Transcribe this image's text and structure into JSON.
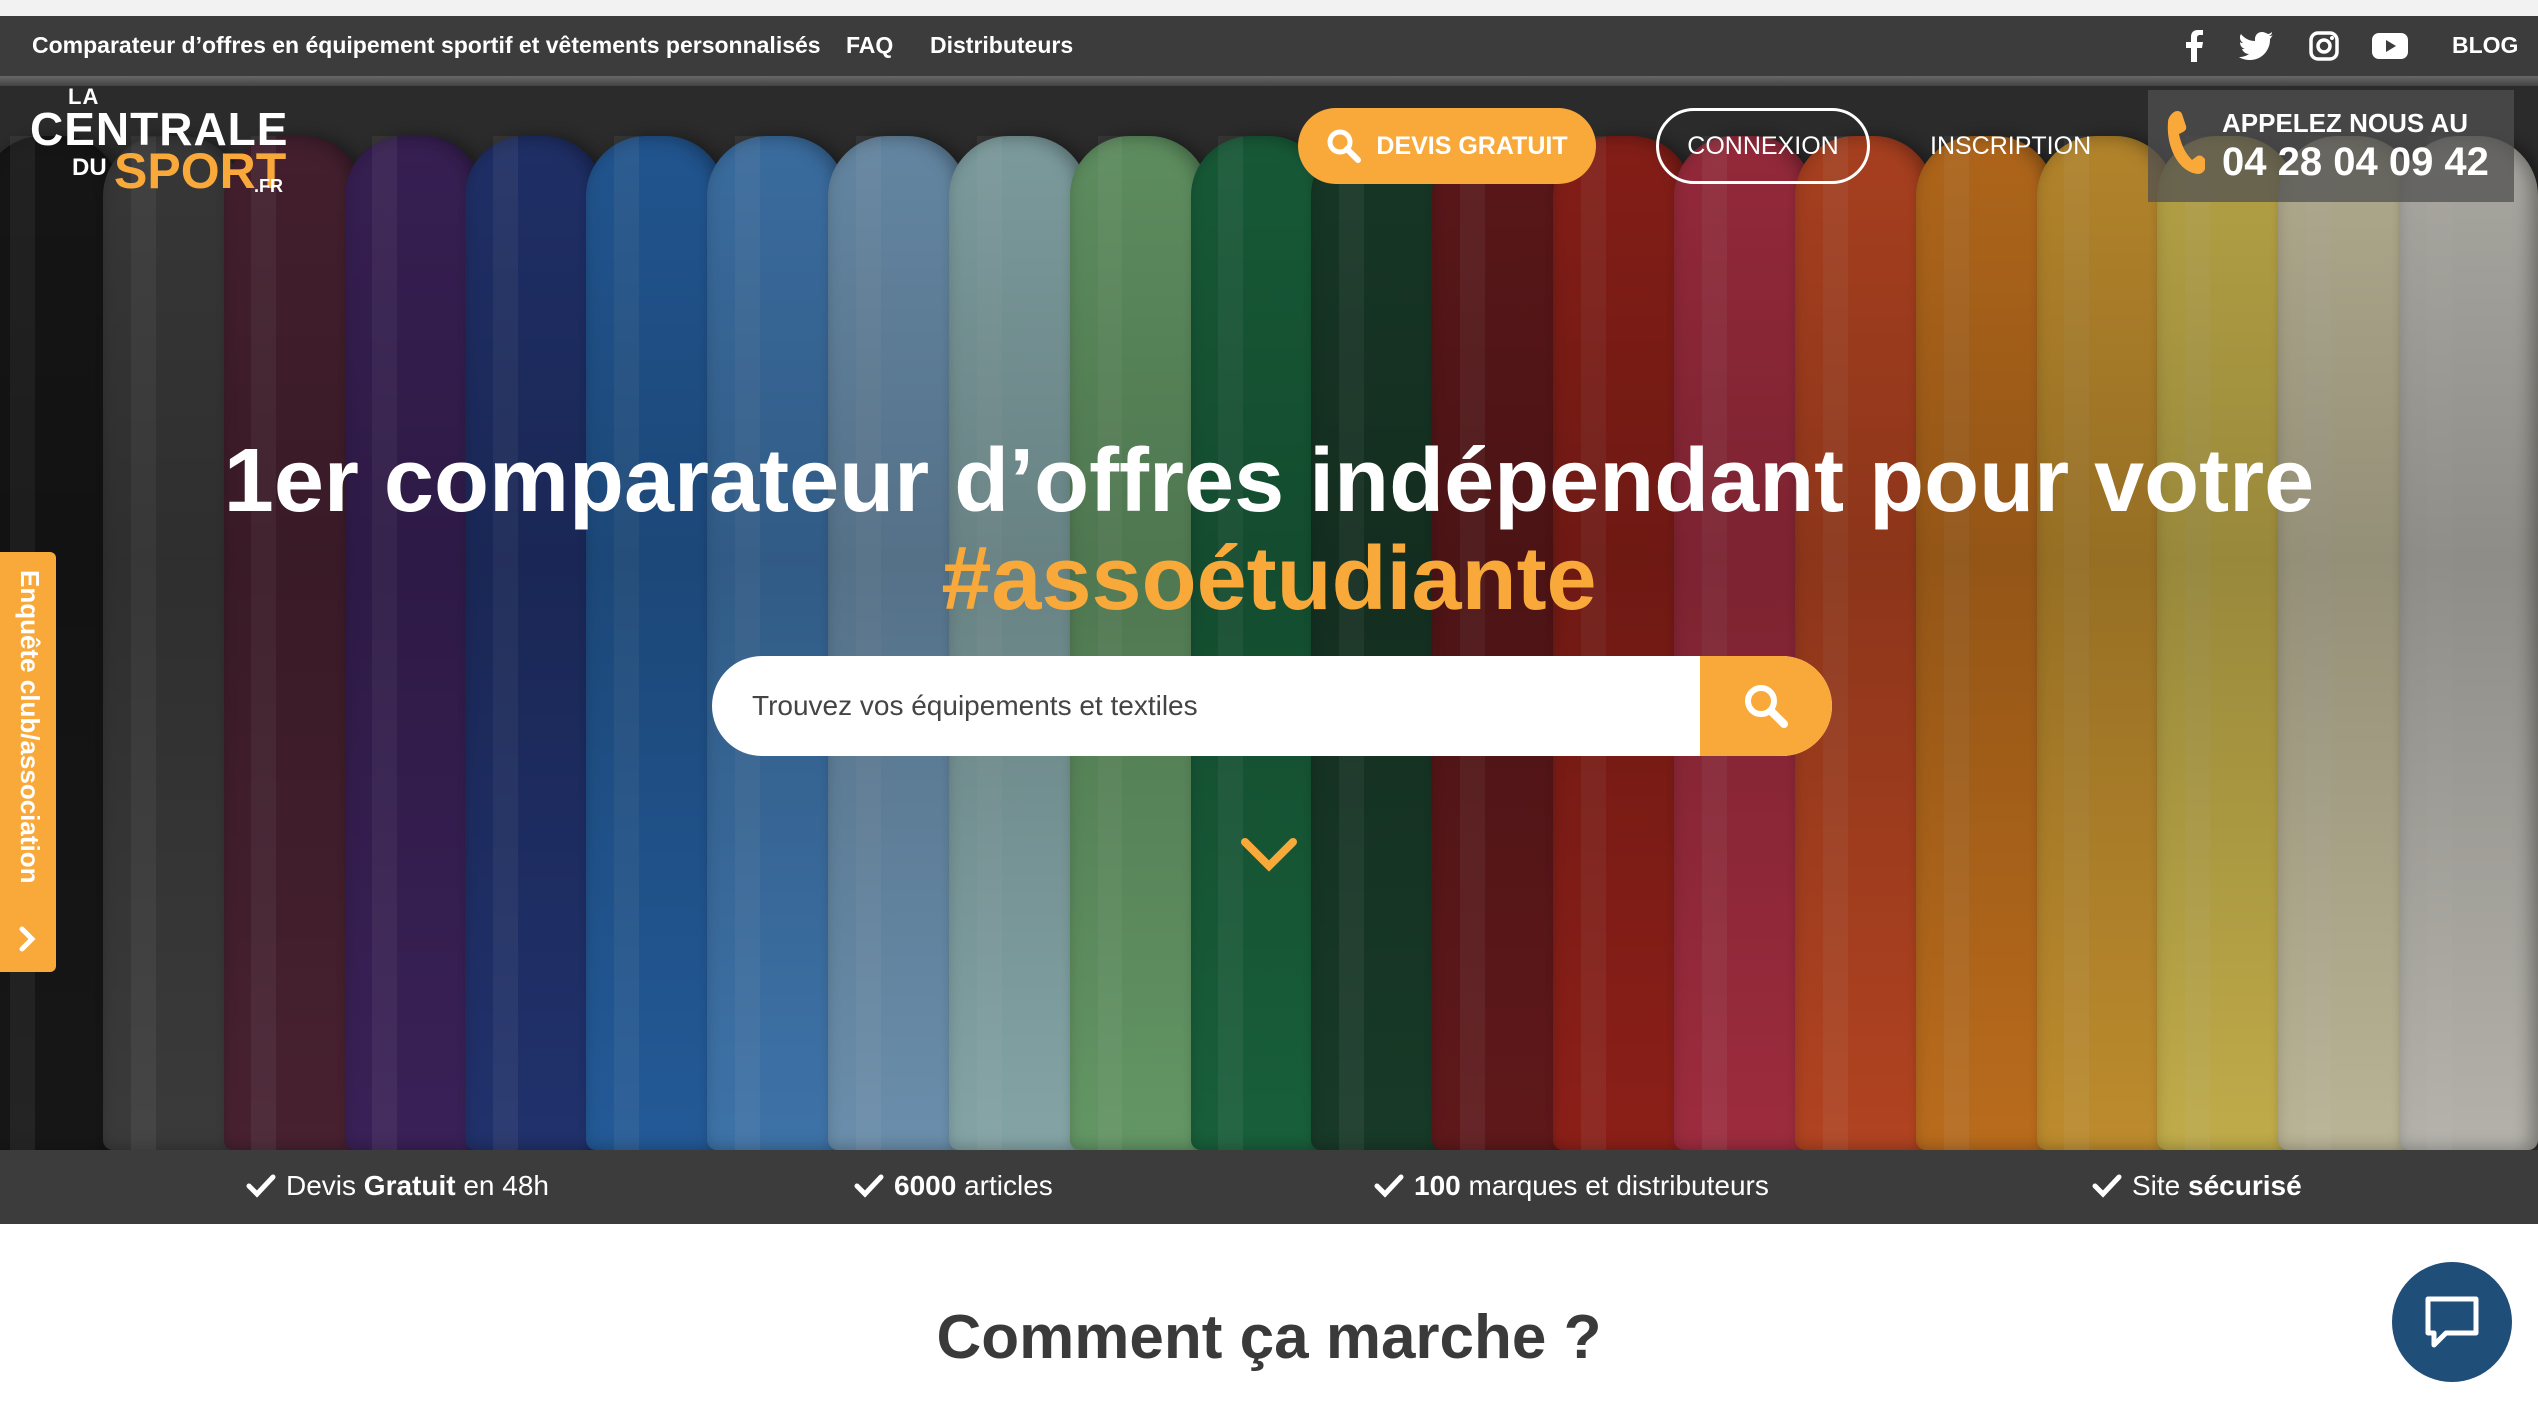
{
  "topbar": {
    "tagline": "Comparateur d’offres en équipement sportif et vêtements personnalisés",
    "faq": "FAQ",
    "distributors": "Distributeurs",
    "blog": "BLOG",
    "social_icons": [
      "facebook-icon",
      "twitter-icon",
      "instagram-icon",
      "youtube-icon"
    ]
  },
  "logo": {
    "line1": "LA",
    "line2": "CENTRALE",
    "line3": "DU",
    "line4": "SPORT",
    "line5": ".FR"
  },
  "header": {
    "devis_label": "DEVIS GRATUIT",
    "connexion_label": "CONNEXION",
    "inscription_label": "INSCRIPTION",
    "phone_label": "APPELEZ NOUS AU",
    "phone_number": "04 28 04 09 42"
  },
  "hero": {
    "title_line1": "1er comparateur d’offres indépendant pour votre",
    "title_accent": "#assoétudiante",
    "search_placeholder": "Trouvez vos équipements et textiles"
  },
  "side_tab": {
    "label": "Enquête club/association"
  },
  "features": [
    {
      "pre": "Devis ",
      "bold": "Gratuit",
      "post": " en 48h"
    },
    {
      "pre": "",
      "bold": "6000",
      "post": " articles"
    },
    {
      "pre": "",
      "bold": "100",
      "post": " marques et distributeurs"
    },
    {
      "pre": "Site ",
      "bold": "sécurisé",
      "post": ""
    }
  ],
  "section": {
    "how_title": "Comment ça marche ?"
  },
  "colors": {
    "accent": "#f9a93a",
    "dark_bar": "#3c3c3c",
    "chat": "#1f4e79"
  }
}
